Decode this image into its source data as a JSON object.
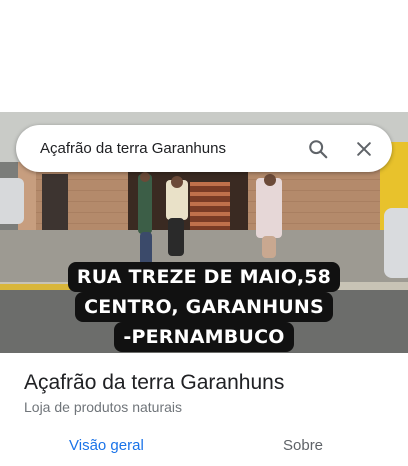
{
  "search": {
    "query": "Açafrão da terra Garanhuns",
    "search_icon": "search-icon",
    "close_icon": "close-icon"
  },
  "photo": {
    "caption_lines": [
      "RUA TREZE DE MAIO,58",
      "CENTRO, GARANHUNS",
      "-PERNAMBUCO"
    ]
  },
  "place": {
    "name": "Açafrão da terra Garanhuns",
    "category": "Loja de produtos naturais"
  },
  "tabs": [
    {
      "label": "Visão geral",
      "active": true
    },
    {
      "label": "Sobre",
      "active": false
    }
  ],
  "colors": {
    "active_tab": "#1a73e8",
    "inactive_tab": "#5f6368"
  }
}
